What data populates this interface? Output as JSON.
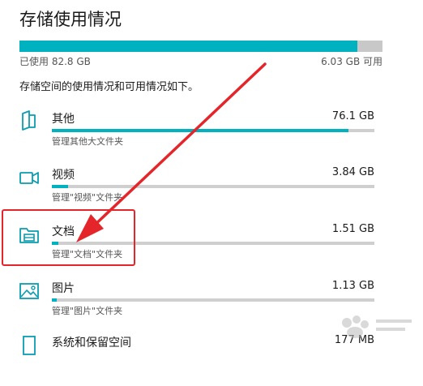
{
  "page": {
    "title": "存储使用情况"
  },
  "storage": {
    "used_label": "已使用 82.8 GB",
    "free_label": "6.03 GB 可用",
    "used_fraction": 0.93,
    "description": "存储空间的使用情况和可用情况如下。"
  },
  "categories": [
    {
      "name": "其他",
      "size": "76.1 GB",
      "link": "管理其他大文件夹",
      "fraction": 0.92,
      "icon": "other-icon"
    },
    {
      "name": "视频",
      "size": "3.84 GB",
      "link": "管理\"视频\"文件夹",
      "fraction": 0.05,
      "icon": "video-icon"
    },
    {
      "name": "文档",
      "size": "1.51 GB",
      "link": "管理\"文档\"文件夹",
      "fraction": 0.02,
      "icon": "documents-folder-icon"
    },
    {
      "name": "图片",
      "size": "1.13 GB",
      "link": "管理\"图片\"文件夹",
      "fraction": 0.015,
      "icon": "pictures-icon"
    },
    {
      "name": "系统和保留空间",
      "size": "177 MB",
      "link": "",
      "fraction": 0.002,
      "icon": "system-icon"
    }
  ],
  "colors": {
    "accent": "#00b2c0",
    "track": "#cfcfcf",
    "annotation": "#e4262a"
  }
}
